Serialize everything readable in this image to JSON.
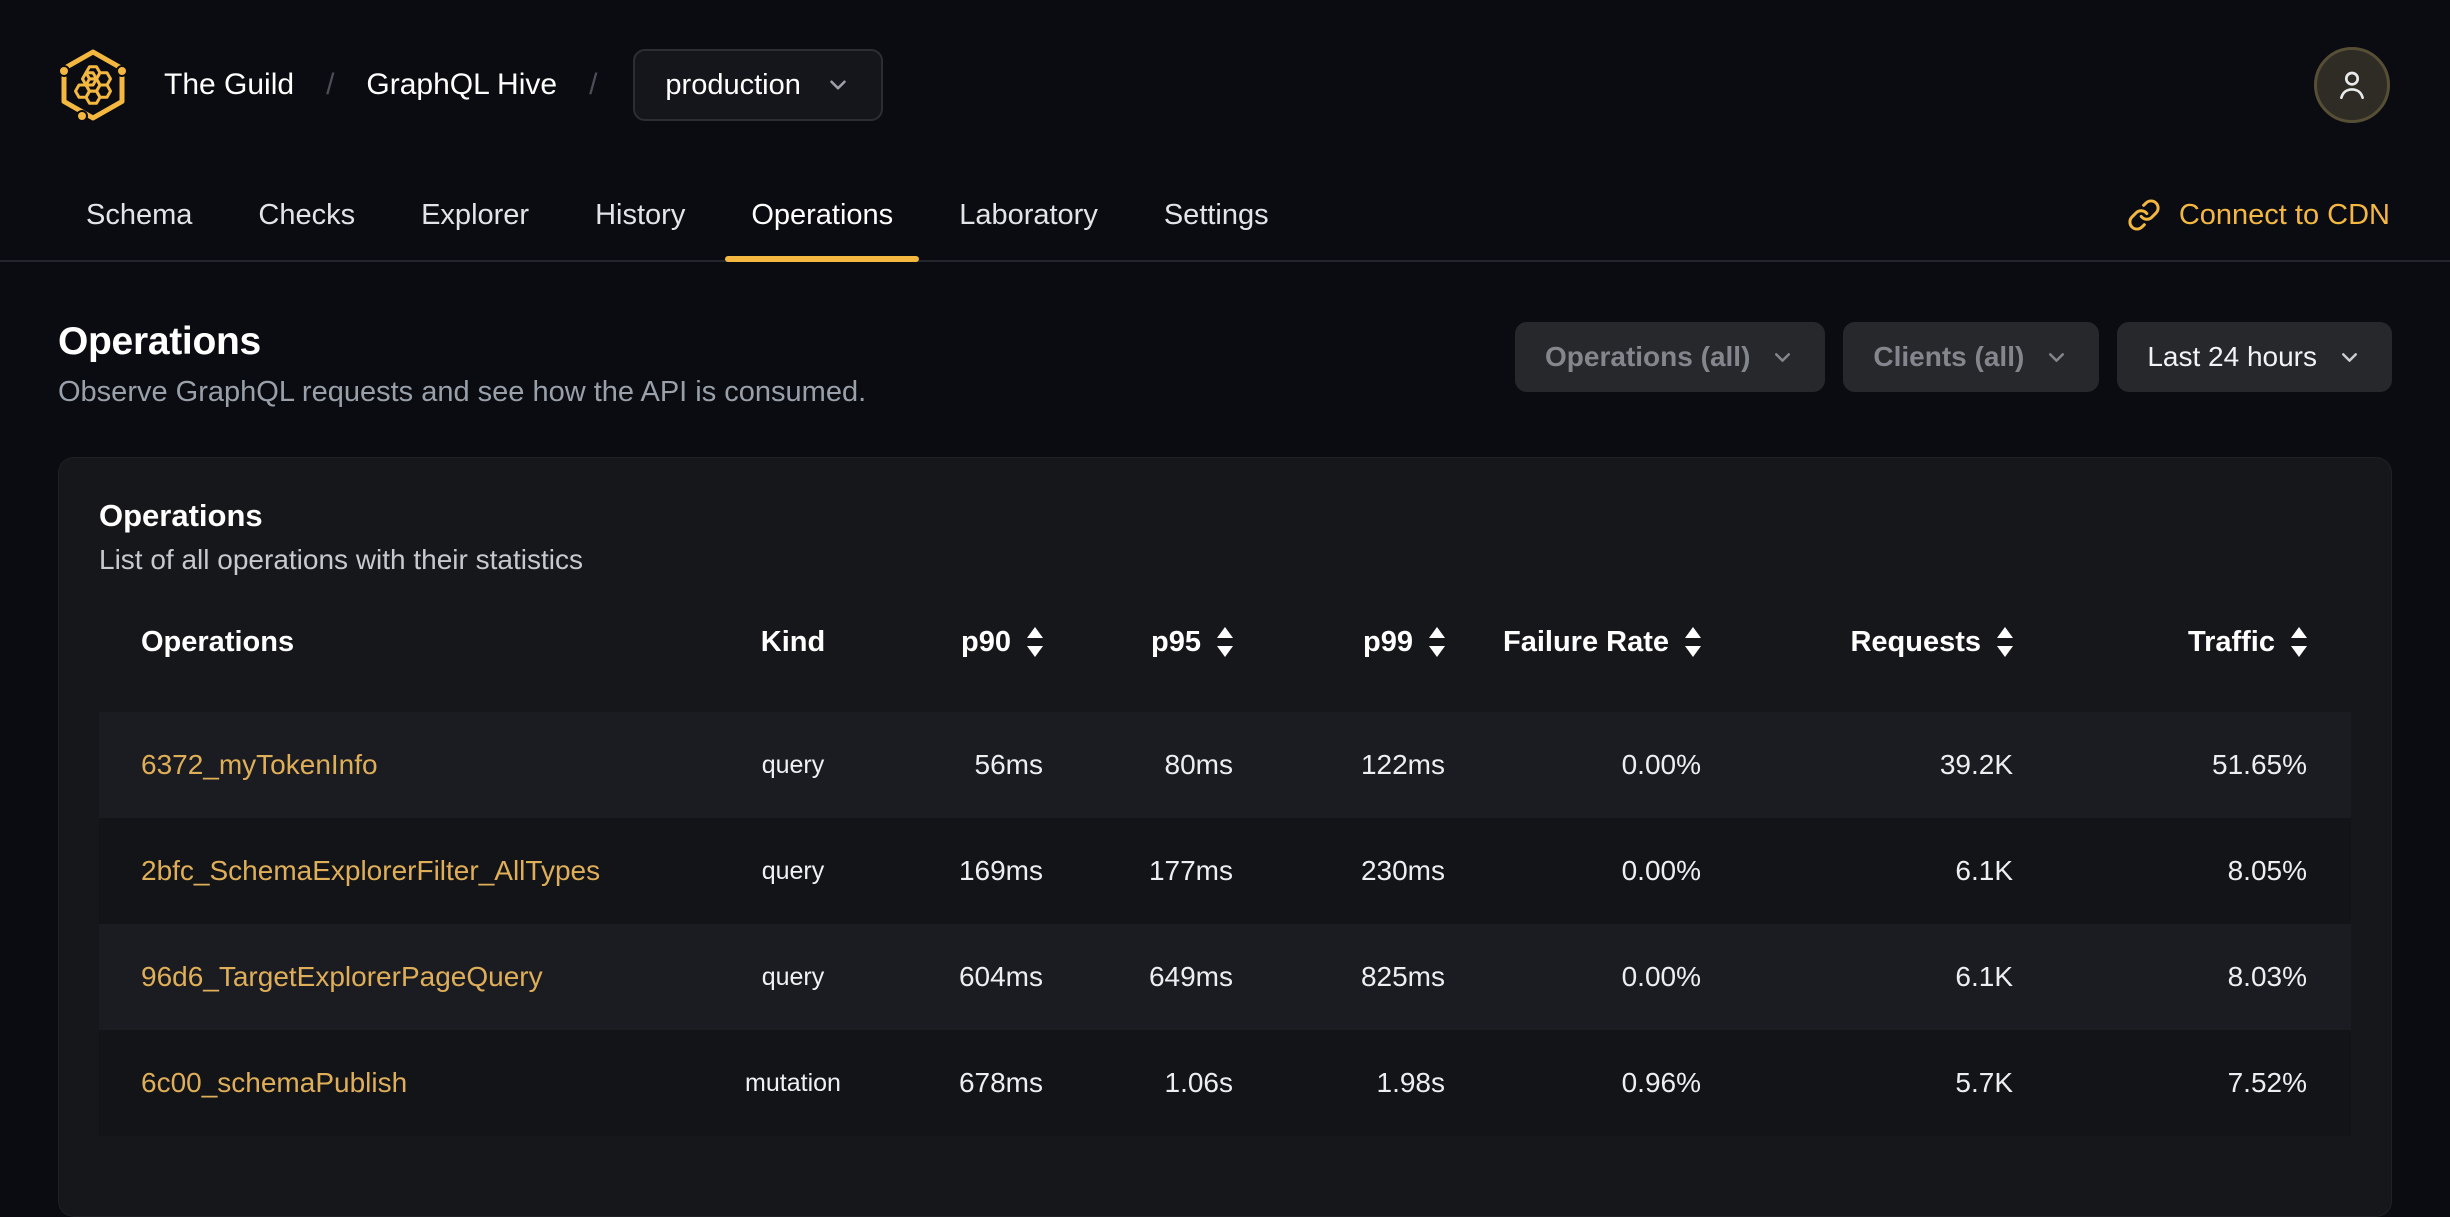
{
  "colors": {
    "accent": "#f4b740",
    "link": "#dfae58"
  },
  "header": {
    "breadcrumb": [
      {
        "label": "The Guild"
      },
      {
        "label": "GraphQL Hive"
      }
    ],
    "separator": "/",
    "target_selector": {
      "label": "production"
    }
  },
  "nav": {
    "tabs": [
      {
        "label": "Schema",
        "active": false
      },
      {
        "label": "Checks",
        "active": false
      },
      {
        "label": "Explorer",
        "active": false
      },
      {
        "label": "History",
        "active": false
      },
      {
        "label": "Operations",
        "active": true
      },
      {
        "label": "Laboratory",
        "active": false
      },
      {
        "label": "Settings",
        "active": false
      }
    ],
    "cdn_link": "Connect to CDN"
  },
  "page": {
    "title": "Operations",
    "subtitle": "Observe GraphQL requests and see how the API is consumed."
  },
  "filters": {
    "items": [
      {
        "label": "Operations (all)",
        "muted": true
      },
      {
        "label": "Clients (all)",
        "muted": true
      },
      {
        "label": "Last 24 hours",
        "muted": false
      }
    ]
  },
  "card": {
    "title": "Operations",
    "subtitle": "List of all operations with their statistics"
  },
  "table": {
    "columns": [
      {
        "key": "name",
        "label": "Operations",
        "sortable": false,
        "align": "left"
      },
      {
        "key": "kind",
        "label": "Kind",
        "sortable": false,
        "align": "center"
      },
      {
        "key": "p90",
        "label": "p90",
        "sortable": true,
        "align": "right"
      },
      {
        "key": "p95",
        "label": "p95",
        "sortable": true,
        "align": "right"
      },
      {
        "key": "p99",
        "label": "p99",
        "sortable": true,
        "align": "right"
      },
      {
        "key": "failure_rate",
        "label": "Failure Rate",
        "sortable": true,
        "align": "right"
      },
      {
        "key": "requests",
        "label": "Requests",
        "sortable": true,
        "align": "right"
      },
      {
        "key": "traffic",
        "label": "Traffic",
        "sortable": true,
        "align": "right"
      }
    ],
    "rows": [
      {
        "name": "6372_myTokenInfo",
        "kind": "query",
        "p90": "56ms",
        "p95": "80ms",
        "p99": "122ms",
        "failure_rate": "0.00%",
        "requests": "39.2K",
        "traffic": "51.65%"
      },
      {
        "name": "2bfc_SchemaExplorerFilter_AllTypes",
        "kind": "query",
        "p90": "169ms",
        "p95": "177ms",
        "p99": "230ms",
        "failure_rate": "0.00%",
        "requests": "6.1K",
        "traffic": "8.05%"
      },
      {
        "name": "96d6_TargetExplorerPageQuery",
        "kind": "query",
        "p90": "604ms",
        "p95": "649ms",
        "p99": "825ms",
        "failure_rate": "0.00%",
        "requests": "6.1K",
        "traffic": "8.03%"
      },
      {
        "name": "6c00_schemaPublish",
        "kind": "mutation",
        "p90": "678ms",
        "p95": "1.06s",
        "p99": "1.98s",
        "failure_rate": "0.96%",
        "requests": "5.7K",
        "traffic": "7.52%"
      }
    ]
  }
}
